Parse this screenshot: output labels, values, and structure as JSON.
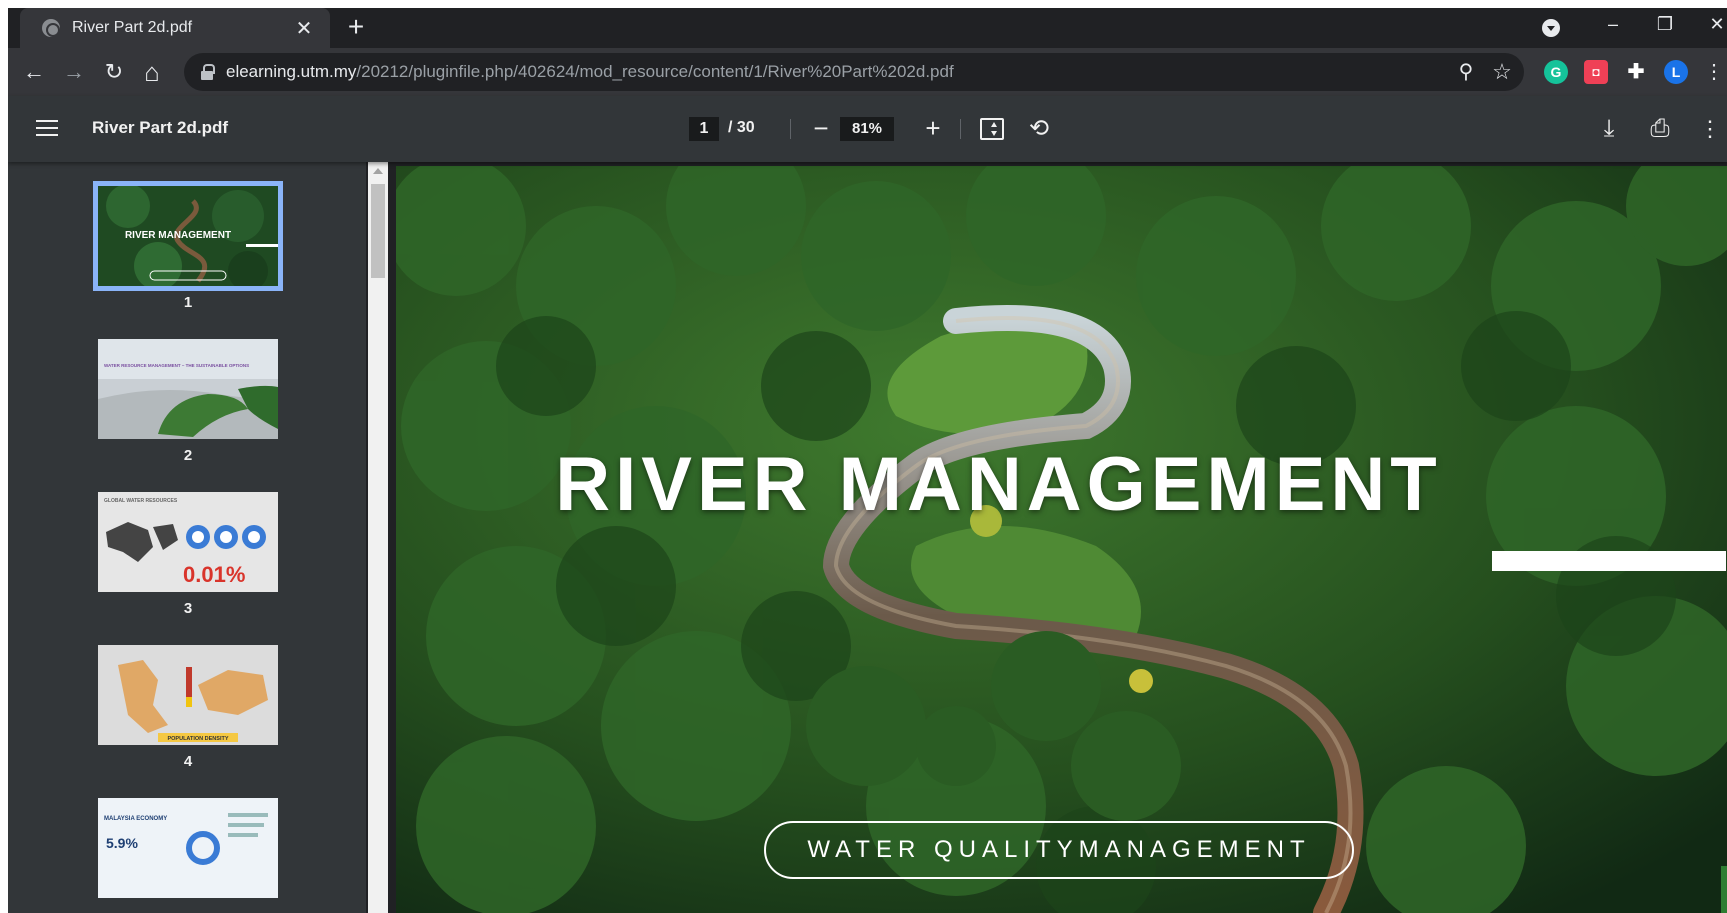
{
  "browser": {
    "tab": {
      "title": "River Part 2d.pdf",
      "close_glyph": "✕"
    },
    "new_tab_glyph": "+",
    "window_controls": {
      "minimize": "–",
      "restore": "❐",
      "close": "✕"
    },
    "address_bar": {
      "host": "elearning.utm.my",
      "path": "/20212/pluginfile.php/402624/mod_resource/content/1/River%20Part%202d.pdf"
    },
    "nav": {
      "back": "←",
      "forward": "→",
      "reload": "↻",
      "home": "⌂"
    },
    "address_icons": {
      "zoom": "⚲",
      "bookmark": "☆"
    },
    "extensions": [
      {
        "name": "grammarly-icon",
        "label": "G",
        "color": "#15c39a"
      },
      {
        "name": "pocket-icon",
        "label": "◘",
        "color": "#ef4056"
      },
      {
        "name": "puzzle-icon",
        "label": "✚",
        "color": "#35363a"
      },
      {
        "name": "profile-avatar",
        "label": "L",
        "color": "#1a73e8"
      }
    ],
    "menu_glyph": "⋮"
  },
  "pdf_toolbar": {
    "title": "River Part 2d.pdf",
    "current_page": "1",
    "total_pages": "/ 30",
    "zoom": "81%",
    "zoom_out_glyph": "−",
    "zoom_in_glyph": "+",
    "rotate_glyph": "⟲",
    "download_glyph": "⤓",
    "print_glyph": "⎙",
    "more_glyph": "⋮"
  },
  "sidebar": {
    "thumbnails": [
      {
        "number": "1",
        "caption": "RIVER MANAGEMENT",
        "selected": true
      },
      {
        "number": "2",
        "caption": "WATER RESOURCE MANAGEMENT – THE SUSTAINABLE OPTIONS",
        "selected": false
      },
      {
        "number": "3",
        "caption": "GLOBAL WATER RESOURCES",
        "value": "0.01%",
        "selected": false
      },
      {
        "number": "4",
        "caption": "POPULATION DENSITY",
        "selected": false
      },
      {
        "number": "5",
        "caption": "MALAYSIA ECONOMY",
        "value": "5.9%",
        "selected": false
      }
    ]
  },
  "page": {
    "title": "RIVER MANAGEMENT",
    "subtitle": "WATER QUALITYMANAGEMENT"
  },
  "colors": {
    "chrome_dark": "#202124",
    "chrome_tab": "#35363a",
    "pdf_bar": "#323639",
    "selected_outline": "#8ab4f8"
  }
}
